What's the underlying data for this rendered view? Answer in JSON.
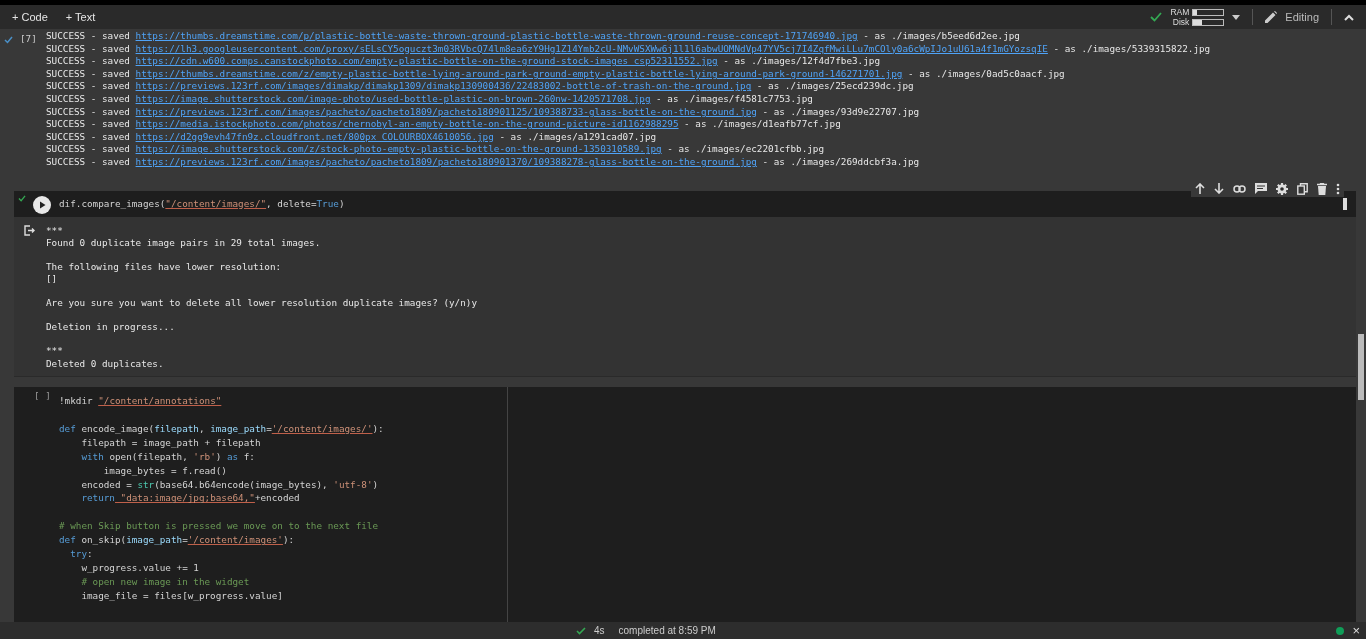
{
  "toolbar": {
    "buttons": [
      {
        "icon": "+",
        "label": "Code"
      },
      {
        "icon": "+",
        "label": "Text"
      }
    ],
    "ram": {
      "label": "RAM",
      "level": 0.12
    },
    "disk": {
      "label": "Disk",
      "level": 0.3
    },
    "mode": "Editing"
  },
  "cells": [
    {
      "kind": "output",
      "counter": "[7]",
      "ran": true,
      "lines": [
        {
          "status": "SUCCESS - saved",
          "url": "https://thumbs.dreamstime.com/p/plastic-bottle-waste-thrown-ground-plastic-bottle-waste-thrown-ground-reuse-concept-171746940.jpg",
          "file": "- as ./images/b5eed6d2ee.jpg"
        },
        {
          "status": "SUCCESS - saved",
          "url": "https://lh3.googleusercontent.com/proxy/sELsCY5oguczt3m03RVbcQ74lm8ea6zY9Hg1Z14Ymb2cU-NMvWSXWw6j1l1l6abwUOMNdVp47YV5cj7I4ZqfMwiLLu7mCOly0a6cWpIJo1uU61a4f1mGYozsqIE",
          "file": "- as ./images/5339315822.jpg"
        },
        {
          "status": "SUCCESS - saved",
          "url": "https://cdn.w600.comps.canstockphoto.com/empty-plastic-bottle-on-the-ground-stock-images_csp52311552.jpg",
          "file": "- as ./images/12f4d7fbe3.jpg"
        },
        {
          "status": "SUCCESS - saved",
          "url": "https://thumbs.dreamstime.com/z/empty-plastic-bottle-lying-around-park-ground-empty-plastic-bottle-lying-around-park-ground-146271701.jpg",
          "file": "- as ./images/0ad5c0aacf.jpg"
        },
        {
          "status": "SUCCESS - saved",
          "url": "https://previews.123rf.com/images/dimakp/dimakp1309/dimakp130900436/22483002-bottle-of-trash-on-the-ground.jpg",
          "file": "- as ./images/25ecd239dc.jpg"
        },
        {
          "status": "SUCCESS - saved",
          "url": "https://image.shutterstock.com/image-photo/used-bottle-plastic-on-brown-260nw-1420571708.jpg",
          "file": "- as ./images/f4581c7753.jpg"
        },
        {
          "status": "SUCCESS - saved",
          "url": "https://previews.123rf.com/images/pacheto/pacheto1809/pacheto180901125/109388733-glass-bottle-on-the-ground.jpg",
          "file": "- as ./images/93d9e22707.jpg"
        },
        {
          "status": "SUCCESS - saved",
          "url": "https://media.istockphoto.com/photos/chernobyl-an-empty-bottle-on-the-ground-picture-id1162988295",
          "file": "- as ./images/d1eafb77cf.jpg"
        },
        {
          "status": "SUCCESS - saved",
          "url": "https://d2gg9evh47fn9z.cloudfront.net/800px_COLOURBOX4610056.jpg",
          "file": "- as ./images/a1291cad07.jpg"
        },
        {
          "status": "SUCCESS - saved",
          "url": "https://image.shutterstock.com/z/stock-photo-empty-plastic-bottle-on-the-ground-1350310589.jpg",
          "file": "- as ./images/ec2201cfbb.jpg"
        },
        {
          "status": "SUCCESS - saved",
          "url": "https://previews.123rf.com/images/pacheto/pacheto1809/pacheto180901370/109388278-glass-bottle-on-the-ground.jpg",
          "file": "- as ./images/269ddcbf3a.jpg"
        }
      ]
    },
    {
      "kind": "code",
      "ran": true,
      "focused": true,
      "code": [
        {
          "tokens": [
            {
              "kind": "plain",
              "text": "dif.compare_images("
            },
            {
              "kind": "str",
              "text": "\"/content/images/\""
            },
            {
              "kind": "plain",
              "text": ", delete="
            },
            {
              "kind": "kw",
              "text": "True"
            },
            {
              "kind": "plain",
              "text": ")"
            }
          ]
        }
      ],
      "output": [
        {
          "text": "***"
        },
        {
          "text": "Found 0 duplicate image pairs in 29 total images."
        },
        {
          "text": "The following files have lower resolution:",
          "spaced": true
        },
        {
          "text": "[]"
        },
        {
          "text": "Are you sure you want to delete all lower resolution duplicate images? (y/n)y",
          "spaced": true
        },
        {
          "text": "Deletion in progress...",
          "spaced": true
        },
        {
          "text": "***",
          "spaced": true
        },
        {
          "text": "Deleted 0 duplicates."
        }
      ]
    },
    {
      "kind": "code",
      "counter": "[ ]",
      "ran": false,
      "focused": false,
      "code": [
        {
          "tokens": [
            {
              "kind": "plain",
              "text": "!mkdir "
            },
            {
              "kind": "str",
              "text": "\"/content/annotations\""
            }
          ]
        },
        {
          "spaced": true,
          "tokens": [
            {
              "kind": "kw",
              "text": "def"
            },
            {
              "kind": "plain",
              "text": " encode_image("
            },
            {
              "kind": "var",
              "text": "filepath"
            },
            {
              "kind": "plain",
              "text": ", "
            },
            {
              "kind": "var",
              "text": "image_path"
            },
            {
              "kind": "plain",
              "text": "="
            },
            {
              "kind": "str",
              "text": "'/content/images/'"
            },
            {
              "kind": "plain",
              "text": "):"
            }
          ]
        },
        {
          "tokens": [
            {
              "kind": "plain",
              "text": "    filepath = image_path + filepath"
            }
          ]
        },
        {
          "tokens": [
            {
              "kind": "kw",
              "text": "    with"
            },
            {
              "kind": "plain",
              "text": " open(filepath, "
            },
            {
              "kind": "str",
              "text": "'rb'"
            },
            {
              "kind": "plain",
              "text": ") "
            },
            {
              "kind": "kw",
              "text": "as"
            },
            {
              "kind": "plain",
              "text": " f:"
            }
          ]
        },
        {
          "tokens": [
            {
              "kind": "plain",
              "text": "        image_bytes = f.read()"
            }
          ]
        },
        {
          "tokens": [
            {
              "kind": "plain",
              "text": "    encoded = "
            },
            {
              "kind": "fn",
              "text": "str"
            },
            {
              "kind": "plain",
              "text": "(base64.b64encode(image_bytes), "
            },
            {
              "kind": "str",
              "text": "'utf-8'"
            },
            {
              "kind": "plain",
              "text": ")"
            }
          ]
        },
        {
          "tokens": [
            {
              "kind": "kw",
              "text": "    return"
            },
            {
              "kind": "str",
              "text": " \"data:image/jpg;base64,\""
            },
            {
              "kind": "plain",
              "text": "+encoded"
            }
          ]
        },
        {
          "spaced": true,
          "tokens": [
            {
              "kind": "cmt",
              "text": "# when Skip button is pressed we move on to the next file"
            }
          ]
        },
        {
          "tokens": [
            {
              "kind": "kw",
              "text": "def"
            },
            {
              "kind": "plain",
              "text": " on_skip("
            },
            {
              "kind": "var",
              "text": "image_path"
            },
            {
              "kind": "plain",
              "text": "="
            },
            {
              "kind": "str",
              "text": "'/content/images'"
            },
            {
              "kind": "plain",
              "text": "):"
            }
          ]
        },
        {
          "tokens": [
            {
              "kind": "kw",
              "text": "  try"
            },
            {
              "kind": "plain",
              "text": ":"
            }
          ]
        },
        {
          "tokens": [
            {
              "kind": "plain",
              "text": "    w_progress.value += 1"
            }
          ]
        },
        {
          "tokens": [
            {
              "kind": "cmt",
              "text": "    # open new image in the widget"
            }
          ]
        },
        {
          "tokens": [
            {
              "kind": "plain",
              "text": "    image_file = files[w_progress.value]"
            }
          ]
        }
      ]
    }
  ],
  "status_bar": {
    "ok": true,
    "duration": "4s",
    "message": "completed at 8:59 PM",
    "connected": true,
    "close": "×"
  }
}
